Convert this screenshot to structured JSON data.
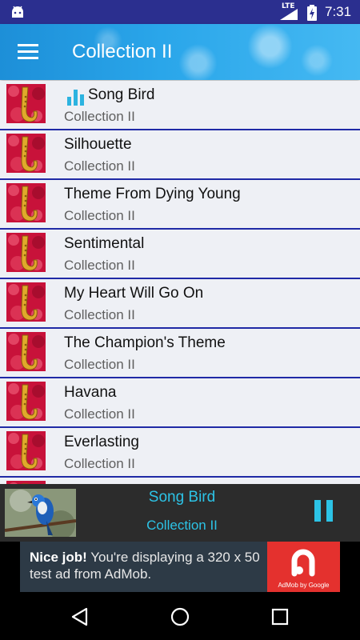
{
  "status_bar": {
    "network_label": "LTE",
    "time": "7:31",
    "icons": [
      "android-icon",
      "signal-icon",
      "battery-charging-icon"
    ]
  },
  "toolbar": {
    "title": "Collection II",
    "menu_icon": "hamburger-menu-icon"
  },
  "songs": [
    {
      "title": "Song Bird",
      "subtitle": "Collection II",
      "playing": true
    },
    {
      "title": "Silhouette",
      "subtitle": "Collection II"
    },
    {
      "title": "Theme From Dying Young",
      "subtitle": "Collection II"
    },
    {
      "title": "Sentimental",
      "subtitle": "Collection II"
    },
    {
      "title": "My Heart Will Go On",
      "subtitle": "Collection II"
    },
    {
      "title": "The Champion's Theme",
      "subtitle": "Collection II"
    },
    {
      "title": "Havana",
      "subtitle": "Collection II"
    },
    {
      "title": "Everlasting",
      "subtitle": "Collection II"
    }
  ],
  "now_playing": {
    "title": "Song Bird",
    "subtitle": "Collection II",
    "control_icon": "pause-icon"
  },
  "ad": {
    "headline": "Nice job!",
    "body": "You're displaying a 320 x 50 test ad from AdMob.",
    "logo_text": "AdMob by Google"
  },
  "nav_bar": {
    "icons": [
      "back-icon",
      "home-icon",
      "recents-icon"
    ]
  },
  "colors": {
    "status_bar": "#2b2f8f",
    "toolbar": "#2aa6ea",
    "row_divider": "#1f2aa6",
    "accent": "#2cc3e6",
    "player_bg": "#2c2c2c",
    "ad_bg": "#2d3a46",
    "ad_logo": "#e4312e"
  }
}
